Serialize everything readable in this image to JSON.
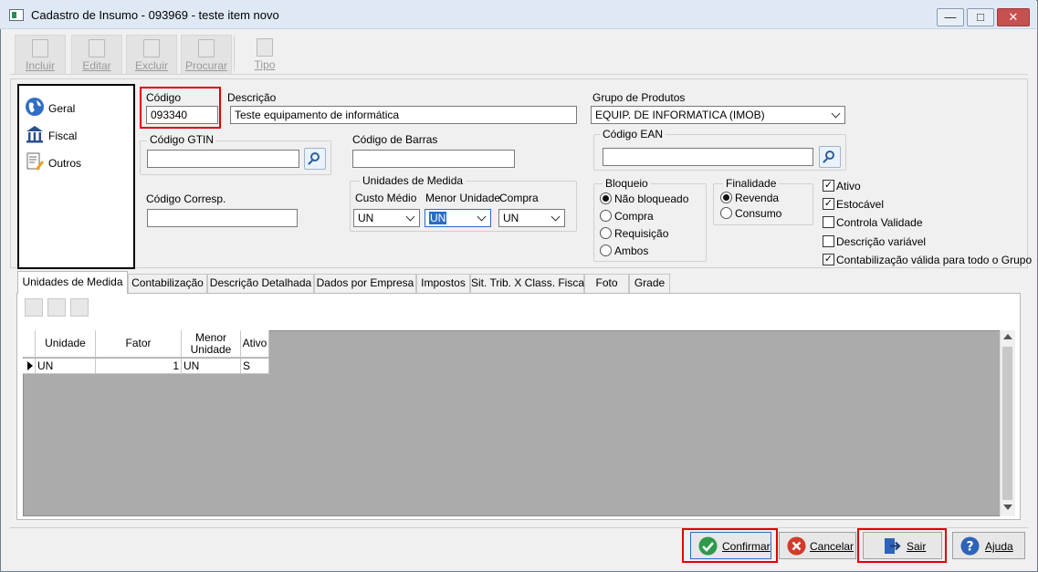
{
  "window": {
    "title": "Cadastro de Insumo - 093969 - teste item novo",
    "minimize": "—",
    "maximize": "□",
    "close": "✕"
  },
  "toolbar": {
    "incluir": "Incluir",
    "editar": "Editar",
    "excluir": "Excluir",
    "procurar": "Procurar",
    "tipo": "Tipo"
  },
  "nav": {
    "items": [
      {
        "label": "Geral",
        "icon": "globe-icon"
      },
      {
        "label": "Fiscal",
        "icon": "bank-icon"
      },
      {
        "label": "Outros",
        "icon": "document-pencil-icon"
      }
    ]
  },
  "form": {
    "codigo_label": "Código",
    "codigo_value": "093340",
    "descricao_label": "Descrição",
    "descricao_value": "Teste equipamento de informática",
    "grupo_label": "Grupo de Produtos",
    "grupo_value": "EQUIP. DE INFORMATICA (IMOB)",
    "gtin_label": "Código GTIN",
    "gtin_value": "",
    "barras_label": "Código de Barras",
    "barras_value": "",
    "ean_label": "Código EAN",
    "ean_value": "",
    "corresp_label": "Código Corresp.",
    "corresp_value": "",
    "unidades_title": "Unidades de Medida",
    "custo_label": "Custo Médio",
    "custo_value": "UN",
    "menor_label": "Menor Unidade",
    "menor_value": "UN",
    "compra_label": "Compra",
    "compra_value": "UN",
    "bloqueio_title": "Bloqueio",
    "bloqueio_options": [
      "Não bloqueado",
      "Compra",
      "Requisição",
      "Ambos"
    ],
    "bloqueio_selected": "Não bloqueado",
    "finalidade_title": "Finalidade",
    "finalidade_options": [
      "Revenda",
      "Consumo"
    ],
    "finalidade_selected": "Revenda",
    "checks": [
      {
        "label": "Ativo",
        "checked": true
      },
      {
        "label": "Estocável",
        "checked": true
      },
      {
        "label": "Controla Validade",
        "checked": false
      },
      {
        "label": "Descrição variável",
        "checked": false
      },
      {
        "label": "Contabilização válida para todo o Grupo",
        "checked": true
      }
    ]
  },
  "tabs": [
    "Unidades de Medida",
    "Contabilização",
    "Descrição Detalhada",
    "Dados por Empresa",
    "Impostos",
    "Sit. Trib. X Class. Fiscal",
    "Foto",
    "Grade"
  ],
  "grid": {
    "columns": [
      "Unidade",
      "Fator",
      "Menor Unidade",
      "Ativo"
    ],
    "rows": [
      {
        "unidade": "UN",
        "fator": "1",
        "menor": "UN",
        "ativo": "S"
      }
    ]
  },
  "buttons": {
    "confirmar": "Confirmar",
    "cancelar": "Cancelar",
    "sair": "Sair",
    "ajuda": "Ajuda"
  },
  "colors": {
    "highlight_red": "#e00000",
    "confirm_green": "#2e9a4a",
    "cancel_red": "#d23a2a",
    "help_blue": "#2d63b8"
  }
}
